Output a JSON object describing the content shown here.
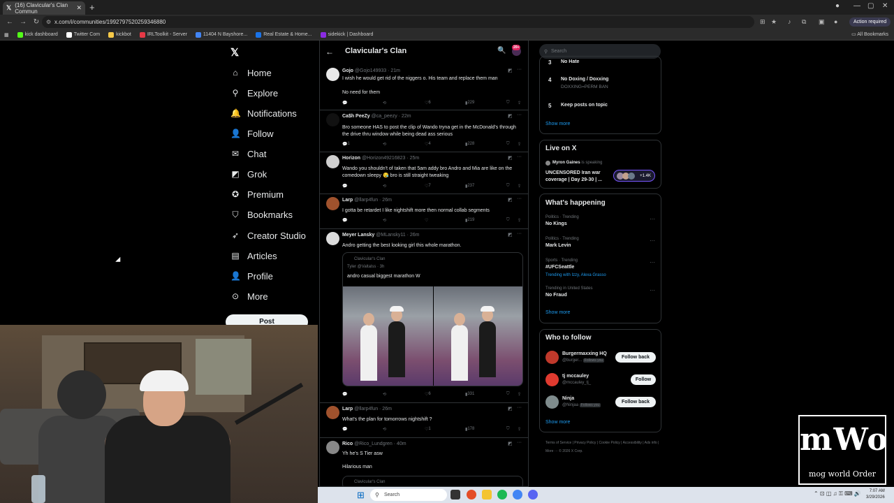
{
  "browser": {
    "tab_title": "(16) Clavicular's Clan Commun",
    "url": "x.com/i/communities/1992797520259346880",
    "action_label": "Action required",
    "bookmarks": [
      {
        "label": "kick dashboard",
        "color": "#53fc18"
      },
      {
        "label": "Twitter Com",
        "color": "#ffffff"
      },
      {
        "label": "kickbot",
        "color": "#f7c948"
      },
      {
        "label": "IRLToolkit - Server",
        "color": "#e63946"
      },
      {
        "label": "11404 N Bayshore...",
        "color": "#4285f4"
      },
      {
        "label": "Real Estate & Home...",
        "color": "#1a73e8"
      },
      {
        "label": "sidekick | Dashboard",
        "color": "#8a2be2"
      }
    ],
    "all_bookmarks": "All Bookmarks"
  },
  "nav": {
    "items": [
      {
        "label": "Home",
        "icon": "home-icon"
      },
      {
        "label": "Explore",
        "icon": "search-icon"
      },
      {
        "label": "Notifications",
        "icon": "bell-icon"
      },
      {
        "label": "Follow",
        "icon": "person-add-icon"
      },
      {
        "label": "Chat",
        "icon": "mail-icon"
      },
      {
        "label": "Grok",
        "icon": "grok-icon"
      },
      {
        "label": "Premium",
        "icon": "x-premium-icon"
      },
      {
        "label": "Bookmarks",
        "icon": "bookmark-icon"
      },
      {
        "label": "Creator Studio",
        "icon": "rocket-icon"
      },
      {
        "label": "Articles",
        "icon": "article-icon"
      },
      {
        "label": "Profile",
        "icon": "profile-icon"
      },
      {
        "label": "More",
        "icon": "more-icon"
      }
    ],
    "post_label": "Post"
  },
  "feed": {
    "title": "Clavicular's Clan",
    "badge": "20+",
    "tweets": [
      {
        "name": "Gojo",
        "handle": "@Gojo149933 · 21m",
        "text": "I wish he would get rid of the niggers o. His team and replace them man",
        "text2": "No need for them",
        "likes": "6",
        "views": "229"
      },
      {
        "name": "Ca$h PeeZy",
        "handle": "@ca_peezy · 22m",
        "text": "Bro someone HAS to post the clip of Wando tryna get in the McDonald's through the drive thru window while being dead ass serious",
        "replies": "1",
        "likes": "4",
        "views": "228"
      },
      {
        "name": "Horizon",
        "handle": "@Horizon49216823 · 25m",
        "text": "Wando you shouldn't of taken that  5am addy bro Andro and Mia are like on the comedown sleepy 😪 bro is still straight tweaking",
        "likes": "7",
        "views": "237"
      },
      {
        "name": "Larp",
        "handle": "@llarp4fun · 26m",
        "text": "I gotta be retardet I like nightshift more then normal collab segments",
        "views": "219"
      },
      {
        "name": "Meyer Lansky",
        "handle": "@MLansky11 · 26m",
        "text": "Andro getting the best looking girl this whole marathon.",
        "quote_community": "Clavicular's Clan",
        "quote_user": "Tyler @Valtalss · 3h",
        "quote_text": "andro casual biggest marathon W",
        "likes": "6",
        "views": "331"
      },
      {
        "name": "Larp",
        "handle": "@llarp4fun · 26m",
        "text": "What's the plan for tomorrows nightshift ?",
        "likes": "1",
        "views": "178"
      },
      {
        "name": "Rico",
        "handle": "@Rico_Lundgren · 40m",
        "text": "Yh he's S Tier asw",
        "text2": "Hilarious man",
        "quote_community": "Clavicular's Clan"
      }
    ]
  },
  "right": {
    "search_placeholder": "Search",
    "rules": [
      {
        "num": "3",
        "title": "No Hate",
        "sub": ""
      },
      {
        "num": "4",
        "title": "No Doxing / Doxxing",
        "sub": "DOXXING=PERM BAN"
      },
      {
        "num": "5",
        "title": "Keep posts on topic",
        "sub": ""
      }
    ],
    "show_more": "Show more",
    "live": {
      "title": "Live on X",
      "host": "Myron Gaines",
      "host_suffix": "is speaking",
      "stream_title": "UNCENSORED Iran war coverage | Day 29-30 | ...",
      "count": "+1.4K"
    },
    "happening": {
      "title": "What's happening",
      "trends": [
        {
          "meta": "Politics · Trending",
          "name": "No Kings",
          "with": ""
        },
        {
          "meta": "Politics · Trending",
          "name": "Mark Levin",
          "with": ""
        },
        {
          "meta": "Sports · Trending",
          "name": "#UFCSeattle",
          "with": "Trending with Izzy, Alexa Grasso"
        },
        {
          "meta": "Trending in United States",
          "name": "No Fraud",
          "with": ""
        }
      ]
    },
    "who_to_follow": {
      "title": "Who to follow",
      "users": [
        {
          "name": "Burgermaxxing HQ",
          "handle": "@burger...",
          "follows_you": "Follows you",
          "button": "Follow back",
          "color": "#c0392b"
        },
        {
          "name": "tj mccauley",
          "handle": "@mccauley_tj_",
          "follows_you": "",
          "button": "Follow",
          "color": "#e03a2f"
        },
        {
          "name": "Ninja",
          "handle": "@Ninjaa",
          "follows_you": "Follows you",
          "button": "Follow back",
          "color": "#7f8c8d"
        }
      ]
    },
    "footer": "Terms of Service  |  Privacy Policy  |  Cookie Policy  |  Accessibility  |  Ads info  |  More ···  © 2026 X Corp."
  },
  "overlay": {
    "logo_big": "mWo",
    "logo_small": "mog world Order"
  },
  "taskbar": {
    "search": "Search",
    "time": "7:07 AM",
    "date": "3/29/2026"
  }
}
